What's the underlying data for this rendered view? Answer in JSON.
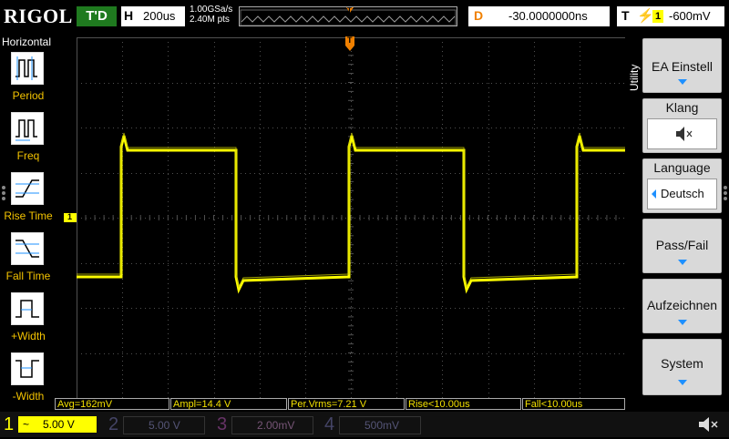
{
  "brand": "RIGOL",
  "status": "T'D",
  "timebase": {
    "key": "H",
    "value": "200us"
  },
  "sample": {
    "rate": "1.00GSa/s",
    "points": "2.40M pts"
  },
  "trigger_track_marker": "T",
  "delay": {
    "key": "D",
    "value": "-30.0000000ns"
  },
  "trigger": {
    "key": "T",
    "channel": "1",
    "level": "-600mV"
  },
  "left_menu": {
    "title": "Horizontal",
    "items": [
      {
        "label": "Period",
        "icon": "period-icon"
      },
      {
        "label": "Freq",
        "icon": "freq-icon"
      },
      {
        "label": "Rise Time",
        "icon": "rise-time-icon"
      },
      {
        "label": "Fall Time",
        "icon": "fall-time-icon"
      },
      {
        "label": "+Width",
        "icon": "positive-width-icon"
      },
      {
        "label": "-Width",
        "icon": "negative-width-icon"
      }
    ]
  },
  "side_menu": {
    "tab": "Utility",
    "ea_einstell": "EA Einstell",
    "klang_title": "Klang",
    "language_title": "Language",
    "language_value": "Deutsch",
    "pass_fail": "Pass/Fail",
    "aufzeichnen": "Aufzeichnen",
    "system": "System"
  },
  "markers": {
    "channel1": "1",
    "trigger": "T"
  },
  "measurements": {
    "avg": "Avg=162mV",
    "ampl": "Ampl=14.4 V",
    "vrms": "Per.Vrms=7.21 V",
    "rise": "Rise<10.00us",
    "fall": "Fall<10.00us"
  },
  "channels": [
    {
      "num": "1",
      "coupling": "~",
      "scale": "5.00 V",
      "color": "#ffff00",
      "active": true
    },
    {
      "num": "2",
      "coupling": "",
      "scale": "5.00 V",
      "color": "#00c8ff",
      "active": false
    },
    {
      "num": "3",
      "coupling": "",
      "scale": "2.00mV",
      "color": "#ff00ff",
      "active": false
    },
    {
      "num": "4",
      "coupling": "",
      "scale": "500mV",
      "color": "#4060ff",
      "active": false
    }
  ],
  "colors": {
    "ch1": "#ffff00",
    "accent": "#1e90ff",
    "trigger": "#f08000",
    "status": "#1f7a1f",
    "grid": "#505050"
  }
}
